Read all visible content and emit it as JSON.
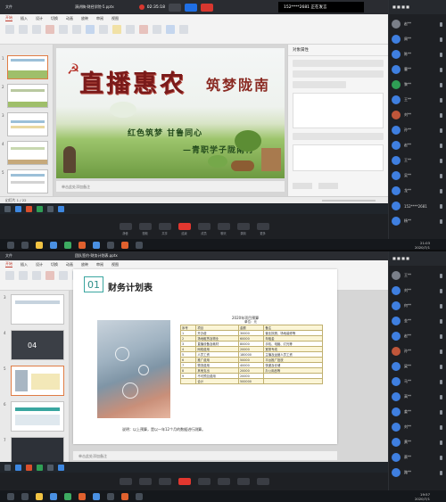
{
  "top": {
    "window_title": "演讲稿-财经学院-5.pptx",
    "meet_tab": "文件",
    "recording_time": "02:35:18",
    "banner_text": "152****2681 正在发言",
    "ribbon_tabs": [
      "开始",
      "插入",
      "设计",
      "切换",
      "动画",
      "放映",
      "审阅",
      "视图"
    ],
    "slide": {
      "calligraphy": "直播惠农",
      "calligraphy2": "筑梦陇南",
      "line1": "红色筑梦  甘鲁同心",
      "line2": "—青职学子陇南行"
    },
    "notes_placeholder": "单击此处添加备注",
    "status_slide": "幻灯片 1 / 22",
    "props_title": "对象属性",
    "taskbar_time": "21:03",
    "taskbar_date": "2020/7/1"
  },
  "bottom": {
    "window_title": "团队签约-财务计划表.pptx",
    "ribbon_tabs": [
      "开始",
      "插入",
      "设计",
      "切换",
      "动画",
      "放映",
      "审阅",
      "视图"
    ],
    "slide": {
      "number": "01",
      "title": "财务计划表",
      "table_caption": "2020年项目预算",
      "table_unit": "单位：元",
      "rows": [
        [
          "序号",
          "项目",
          "金额",
          "备注"
        ],
        [
          "1",
          "开办费",
          "30000",
          "营业执照、场地装修等"
        ],
        [
          "2",
          "场地租赁及物业",
          "60000",
          "年租金"
        ],
        [
          "3",
          "直播设备及耗材",
          "80000",
          "手机、电脑、灯光等"
        ],
        [
          "4",
          "网络费用",
          "20000",
          "宽带专线"
        ],
        [
          "5",
          "人员工资",
          "180000",
          "主播及运营人员工资"
        ],
        [
          "6",
          "推广费用",
          "50000",
          "平台推广投放"
        ],
        [
          "7",
          "物流费用",
          "40000",
          "快递及仓储"
        ],
        [
          "8",
          "其他支出",
          "20000",
          "办公用品等"
        ],
        [
          "9",
          "不可预见费用",
          "20000",
          ""
        ],
        [
          "",
          "合计",
          "500000",
          ""
        ]
      ],
      "note": "说明：以上预算，是以一年12个月的数据进行测算。"
    },
    "notes_placeholder": "单击此处添加备注",
    "taskbar_time": "19:57",
    "taskbar_date": "2020/7/1"
  },
  "participants_top": [
    "赵**",
    "周**",
    "陈**",
    "曹**",
    "黎**",
    "王**",
    "刘**",
    "孙**",
    "赵**",
    "王**",
    "吴**",
    "龙**",
    "152****2681",
    "杨**"
  ],
  "participants_bottom": [
    "王**",
    "刘**",
    "何**",
    "金**",
    "赵**",
    "孙**",
    "梁**",
    "马**",
    "高**",
    "姜**",
    "刘**",
    "黄**",
    "蔡**",
    "路**"
  ],
  "controls": [
    "静音",
    "视频",
    "共享",
    "结束",
    "成员",
    "聊天",
    "录制",
    "更多"
  ],
  "colors": {
    "accent": "#d8372f",
    "meeting_bg": "#1e2024",
    "avatar": "#3f7fe0"
  }
}
